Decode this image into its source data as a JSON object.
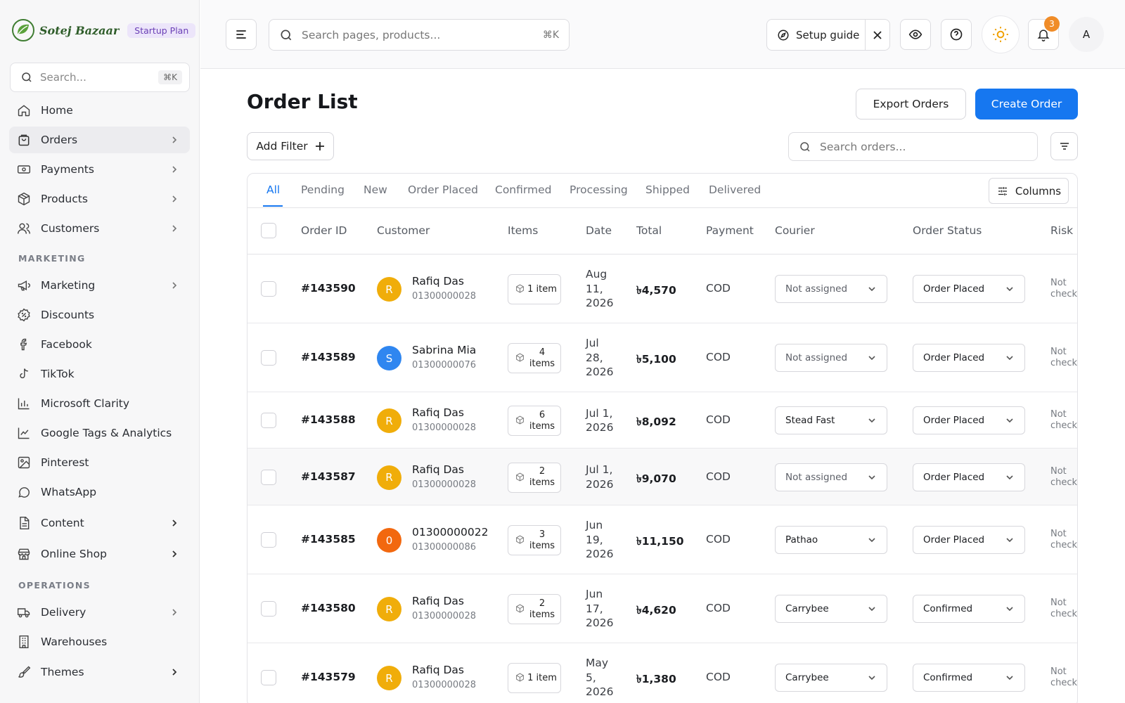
{
  "brand": {
    "name": "Sotej Bazaar",
    "plan": "Startup Plan"
  },
  "sidebar": {
    "search_placeholder": "Search...",
    "search_shortcut": "⌘K",
    "items": [
      {
        "label": "Home",
        "icon": "home-icon"
      },
      {
        "label": "Orders",
        "icon": "shopping-bag-icon",
        "active": true,
        "chevron": true
      },
      {
        "label": "Payments",
        "icon": "banknote-icon",
        "chevron": true
      },
      {
        "label": "Products",
        "icon": "box-icon",
        "chevron": true
      },
      {
        "label": "Customers",
        "icon": "users-icon",
        "chevron": true
      }
    ],
    "marketing_label": "MARKETING",
    "marketing_items": [
      {
        "label": "Marketing",
        "icon": "megaphone-icon",
        "chevron": true
      },
      {
        "label": "Discounts",
        "icon": "percent-badge-icon"
      },
      {
        "label": "Facebook",
        "icon": "facebook-icon"
      },
      {
        "label": "TikTok",
        "icon": "tiktok-icon"
      },
      {
        "label": "Microsoft Clarity",
        "icon": "bar-chart-icon"
      },
      {
        "label": "Google Tags & Analytics",
        "icon": "line-chart-icon"
      },
      {
        "label": "Pinterest",
        "icon": "image-icon"
      },
      {
        "label": "WhatsApp",
        "icon": "chat-icon"
      },
      {
        "label": "Content",
        "icon": "document-icon",
        "chevron": true
      },
      {
        "label": "Online Shop",
        "icon": "store-icon",
        "chevron": true
      }
    ],
    "operations_label": "OPERATIONS",
    "operations_items": [
      {
        "label": "Delivery",
        "icon": "truck-icon",
        "chevron": true
      },
      {
        "label": "Warehouses",
        "icon": "building-icon"
      },
      {
        "label": "Themes",
        "icon": "paintbrush-icon",
        "chevron": true
      }
    ]
  },
  "topbar": {
    "search_placeholder": "Search pages, products...",
    "search_shortcut": "⌘K",
    "setup_guide": "Setup guide",
    "notification_count": "3",
    "avatar_initial": "A"
  },
  "page": {
    "title": "Order List",
    "export_label": "Export Orders",
    "create_label": "Create Order",
    "add_filter_label": "Add Filter",
    "search_orders_placeholder": "Search orders...",
    "columns_label": "Columns"
  },
  "tabs": [
    "All",
    "Pending",
    "New",
    "Order Placed",
    "Confirmed",
    "Processing",
    "Shipped",
    "Delivered"
  ],
  "columns": [
    "Order ID",
    "Customer",
    "Items",
    "Date",
    "Total",
    "Payment",
    "Courier",
    "Order Status",
    "Risk"
  ],
  "orders": [
    {
      "id": "#143590",
      "initial": "R",
      "avatar_color": "#f0ad0a",
      "name": "Rafiq Das",
      "phone": "01300000028",
      "items": "1 item",
      "date": [
        "Aug",
        "11,",
        "2026"
      ],
      "total": "৳4,570",
      "payment": "COD",
      "courier": "Not assigned",
      "status": "Order Placed",
      "risk": "Not checked"
    },
    {
      "id": "#143589",
      "initial": "S",
      "avatar_color": "#2f86f0",
      "name": "Sabrina Mia",
      "phone": "01300000076",
      "items": "4 items",
      "date": [
        "Jul",
        "28,",
        "2026"
      ],
      "total": "৳5,100",
      "payment": "COD",
      "courier": "Not assigned",
      "status": "Order Placed",
      "risk": "Not checked"
    },
    {
      "id": "#143588",
      "initial": "R",
      "avatar_color": "#f0ad0a",
      "name": "Rafiq Das",
      "phone": "01300000028",
      "items": "6 items",
      "date": [
        "Jul 1,",
        "2026"
      ],
      "total": "৳8,092",
      "payment": "COD",
      "courier": "Stead Fast",
      "status": "Order Placed",
      "risk": "Not checked"
    },
    {
      "id": "#143587",
      "initial": "R",
      "avatar_color": "#f0ad0a",
      "name": "Rafiq Das",
      "phone": "01300000028",
      "items": "2 items",
      "date": [
        "Jul 1,",
        "2026"
      ],
      "total": "৳9,070",
      "payment": "COD",
      "courier": "Not assigned",
      "status": "Order Placed",
      "risk": "Not checked"
    },
    {
      "id": "#143585",
      "initial": "0",
      "avatar_color": "#f2680f",
      "name": "01300000022",
      "phone": "01300000086",
      "items": "3 items",
      "date": [
        "Jun",
        "19,",
        "2026"
      ],
      "total": "৳11,150",
      "payment": "COD",
      "courier": "Pathao",
      "status": "Order Placed",
      "risk": "Not checked"
    },
    {
      "id": "#143580",
      "initial": "R",
      "avatar_color": "#f0ad0a",
      "name": "Rafiq Das",
      "phone": "01300000028",
      "items": "2 items",
      "date": [
        "Jun",
        "17,",
        "2026"
      ],
      "total": "৳4,620",
      "payment": "COD",
      "courier": "Carrybee",
      "status": "Confirmed",
      "risk": "Not checked"
    },
    {
      "id": "#143579",
      "initial": "R",
      "avatar_color": "#f0ad0a",
      "name": "Rafiq Das",
      "phone": "01300000028",
      "items": "1 item",
      "date": [
        "May",
        "5,",
        "2026"
      ],
      "total": "৳1,380",
      "payment": "COD",
      "courier": "Carrybee",
      "status": "Confirmed",
      "risk": "Not checked"
    }
  ]
}
